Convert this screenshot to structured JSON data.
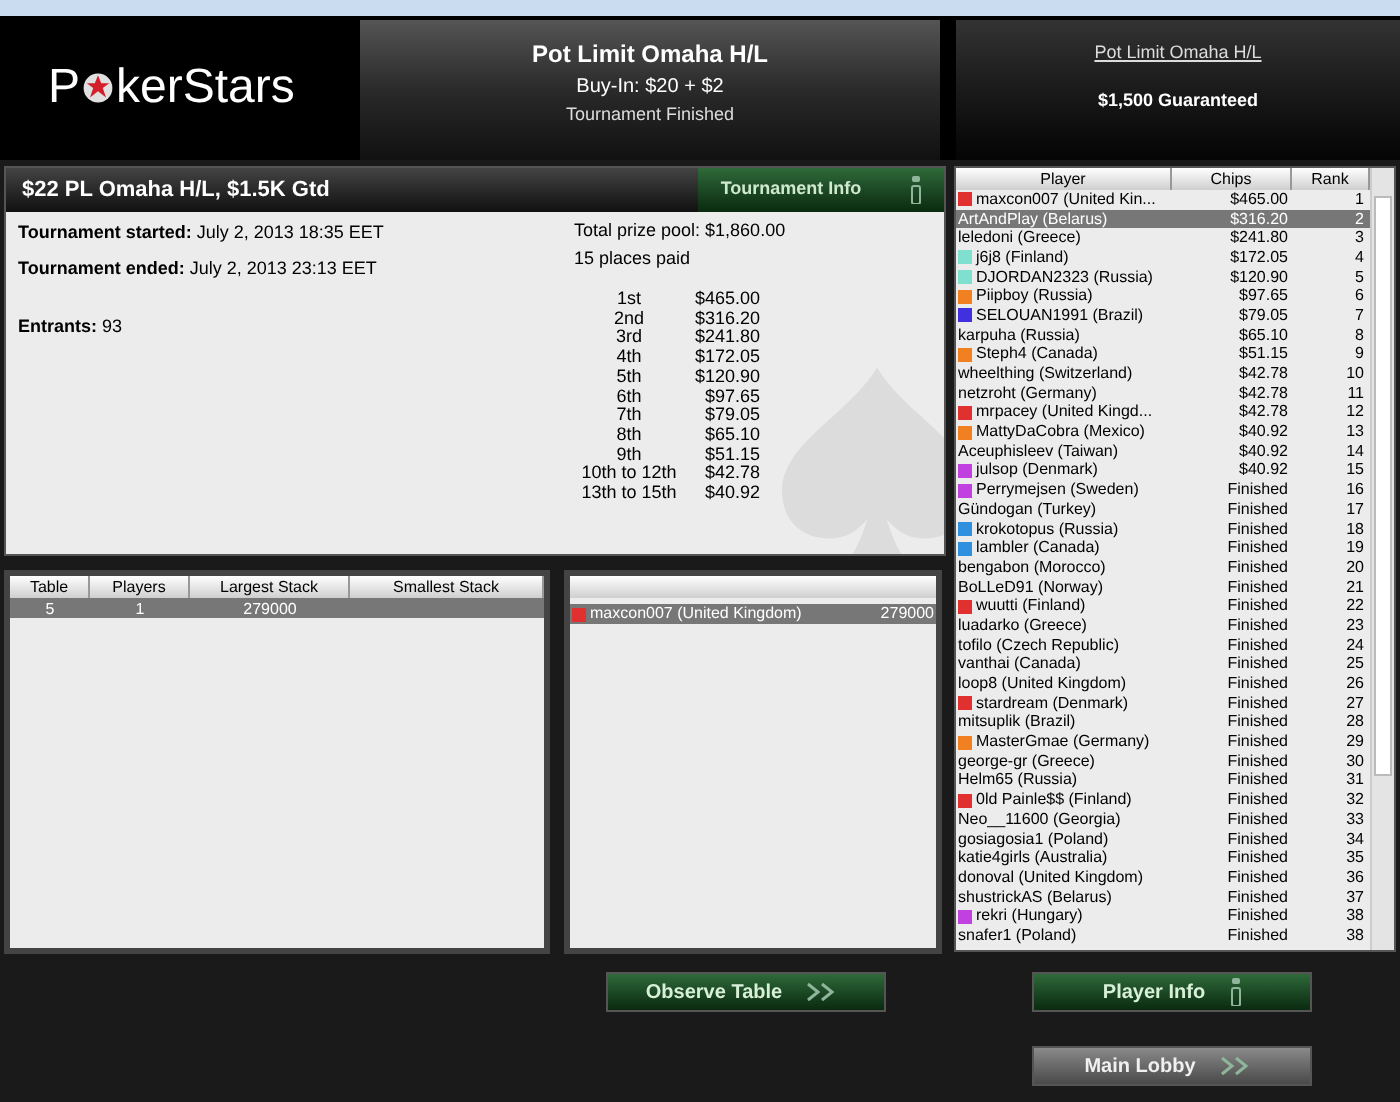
{
  "logo": {
    "parts": [
      "P",
      "kerStars"
    ]
  },
  "header": {
    "title": "Pot Limit Omaha H/L",
    "buyin": "Buy-In: $20 + $2",
    "status": "Tournament Finished"
  },
  "side_header": {
    "link": "Pot Limit Omaha H/L",
    "guarantee": "$1,500 Guaranteed"
  },
  "info_panel": {
    "title": "$22 PL Omaha H/L, $1.5K Gtd",
    "tab": "Tournament Info",
    "fields": [
      {
        "label": "Tournament started:",
        "value": "July 2, 2013 18:35 EET"
      },
      {
        "label": "Tournament ended:",
        "value": "July 2, 2013 23:13 EET"
      },
      {
        "label": "Entrants:",
        "value": "93"
      }
    ],
    "prize_pool": "Total prize pool: $1,860.00",
    "places_paid": "15 places paid",
    "payouts": [
      {
        "place": "1st",
        "amount": "$465.00"
      },
      {
        "place": "2nd",
        "amount": "$316.20"
      },
      {
        "place": "3rd",
        "amount": "$241.80"
      },
      {
        "place": "4th",
        "amount": "$172.05"
      },
      {
        "place": "5th",
        "amount": "$120.90"
      },
      {
        "place": "6th",
        "amount": "$97.65"
      },
      {
        "place": "7th",
        "amount": "$79.05"
      },
      {
        "place": "8th",
        "amount": "$65.10"
      },
      {
        "place": "9th",
        "amount": "$51.15"
      },
      {
        "place": "10th to 12th",
        "amount": "$42.78"
      },
      {
        "place": "13th to 15th",
        "amount": "$40.92"
      }
    ]
  },
  "players": {
    "columns": [
      "Player",
      "Chips",
      "Rank"
    ],
    "rows": [
      {
        "name": "maxcon007 (United Kin...",
        "chips": "$465.00",
        "rank": "1",
        "color": "#e03030",
        "selected": false
      },
      {
        "name": "ArtAndPlay (Belarus)",
        "chips": "$316.20",
        "rank": "2",
        "selected": true
      },
      {
        "name": "leledoni (Greece)",
        "chips": "$241.80",
        "rank": "3",
        "selected": false
      },
      {
        "name": "j6j8 (Finland)",
        "chips": "$172.05",
        "rank": "4",
        "color": "#80e0d0",
        "selected": false
      },
      {
        "name": "DJORDAN2323 (Russia)",
        "chips": "$120.90",
        "rank": "5",
        "color": "#80e0d0",
        "selected": false
      },
      {
        "name": "Piipboy (Russia)",
        "chips": "$97.65",
        "rank": "6",
        "color": "#f08020",
        "selected": false
      },
      {
        "name": "SELOUAN1991 (Brazil)",
        "chips": "$79.05",
        "rank": "7",
        "color": "#4030e0",
        "selected": false
      },
      {
        "name": "karpuha (Russia)",
        "chips": "$65.10",
        "rank": "8",
        "selected": false
      },
      {
        "name": "Steph4 (Canada)",
        "chips": "$51.15",
        "rank": "9",
        "color": "#f08020",
        "selected": false
      },
      {
        "name": "wheelthing (Switzerland)",
        "chips": "$42.78",
        "rank": "10",
        "selected": false
      },
      {
        "name": "netzroht (Germany)",
        "chips": "$42.78",
        "rank": "11",
        "selected": false
      },
      {
        "name": "mrpacey (United Kingd...",
        "chips": "$42.78",
        "rank": "12",
        "color": "#e03030",
        "selected": false
      },
      {
        "name": "MattyDaCobra (Mexico)",
        "chips": "$40.92",
        "rank": "13",
        "color": "#f08020",
        "selected": false
      },
      {
        "name": "Aceuphisleev (Taiwan)",
        "chips": "$40.92",
        "rank": "14",
        "selected": false
      },
      {
        "name": "julsop (Denmark)",
        "chips": "$40.92",
        "rank": "15",
        "color": "#c040e0",
        "selected": false
      },
      {
        "name": "Perrymejsen (Sweden)",
        "chips": "Finished",
        "rank": "16",
        "color": "#c040e0",
        "selected": false
      },
      {
        "name": "Gündogan (Turkey)",
        "chips": "Finished",
        "rank": "17",
        "selected": false
      },
      {
        "name": "krokotopus (Russia)",
        "chips": "Finished",
        "rank": "18",
        "color": "#3090e0",
        "selected": false
      },
      {
        "name": "lambler (Canada)",
        "chips": "Finished",
        "rank": "19",
        "color": "#3090e0",
        "selected": false
      },
      {
        "name": "bengabon (Morocco)",
        "chips": "Finished",
        "rank": "20",
        "selected": false
      },
      {
        "name": "BoLLeD91 (Norway)",
        "chips": "Finished",
        "rank": "21",
        "selected": false
      },
      {
        "name": "wuutti (Finland)",
        "chips": "Finished",
        "rank": "22",
        "color": "#e03030",
        "selected": false
      },
      {
        "name": "luadarko (Greece)",
        "chips": "Finished",
        "rank": "23",
        "selected": false
      },
      {
        "name": "tofilo (Czech Republic)",
        "chips": "Finished",
        "rank": "24",
        "selected": false
      },
      {
        "name": "vanthai (Canada)",
        "chips": "Finished",
        "rank": "25",
        "selected": false
      },
      {
        "name": "loop8 (United Kingdom)",
        "chips": "Finished",
        "rank": "26",
        "selected": false
      },
      {
        "name": "stardream (Denmark)",
        "chips": "Finished",
        "rank": "27",
        "color": "#e03030",
        "selected": false
      },
      {
        "name": "mitsuplik (Brazil)",
        "chips": "Finished",
        "rank": "28",
        "selected": false
      },
      {
        "name": "MasterGmae (Germany)",
        "chips": "Finished",
        "rank": "29",
        "color": "#f08020",
        "selected": false
      },
      {
        "name": "george-gr (Greece)",
        "chips": "Finished",
        "rank": "30",
        "selected": false
      },
      {
        "name": "Helm65 (Russia)",
        "chips": "Finished",
        "rank": "31",
        "selected": false
      },
      {
        "name": "0ld Painle$$ (Finland)",
        "chips": "Finished",
        "rank": "32",
        "color": "#e03030",
        "selected": false
      },
      {
        "name": "Neo__11600 (Georgia)",
        "chips": "Finished",
        "rank": "33",
        "selected": false
      },
      {
        "name": "gosiagosia1 (Poland)",
        "chips": "Finished",
        "rank": "34",
        "selected": false
      },
      {
        "name": "katie4girls (Australia)",
        "chips": "Finished",
        "rank": "35",
        "selected": false
      },
      {
        "name": "donoval (United Kingdom)",
        "chips": "Finished",
        "rank": "36",
        "selected": false
      },
      {
        "name": "shustrickAS (Belarus)",
        "chips": "Finished",
        "rank": "37",
        "selected": false
      },
      {
        "name": "rekri (Hungary)",
        "chips": "Finished",
        "rank": "38",
        "color": "#c040e0",
        "selected": false
      },
      {
        "name": "snafer1 (Poland)",
        "chips": "Finished",
        "rank": "38",
        "selected": false
      }
    ]
  },
  "tables": {
    "columns": [
      "Table",
      "Players",
      "Largest Stack",
      "Smallest Stack"
    ],
    "rows": [
      {
        "cells": [
          "5",
          "1",
          "279000"
        ],
        "selected": true
      }
    ]
  },
  "table_players": {
    "rows": [
      {
        "name": "maxcon007 (United Kingdom)",
        "stack": "279000",
        "color": "#e03030",
        "selected": true
      }
    ]
  },
  "buttons": [
    {
      "label": "Observe Table",
      "kind": "observe"
    },
    {
      "label": "Player Info",
      "kind": "info"
    },
    {
      "label": "Main Lobby",
      "kind": "lobby"
    }
  ]
}
